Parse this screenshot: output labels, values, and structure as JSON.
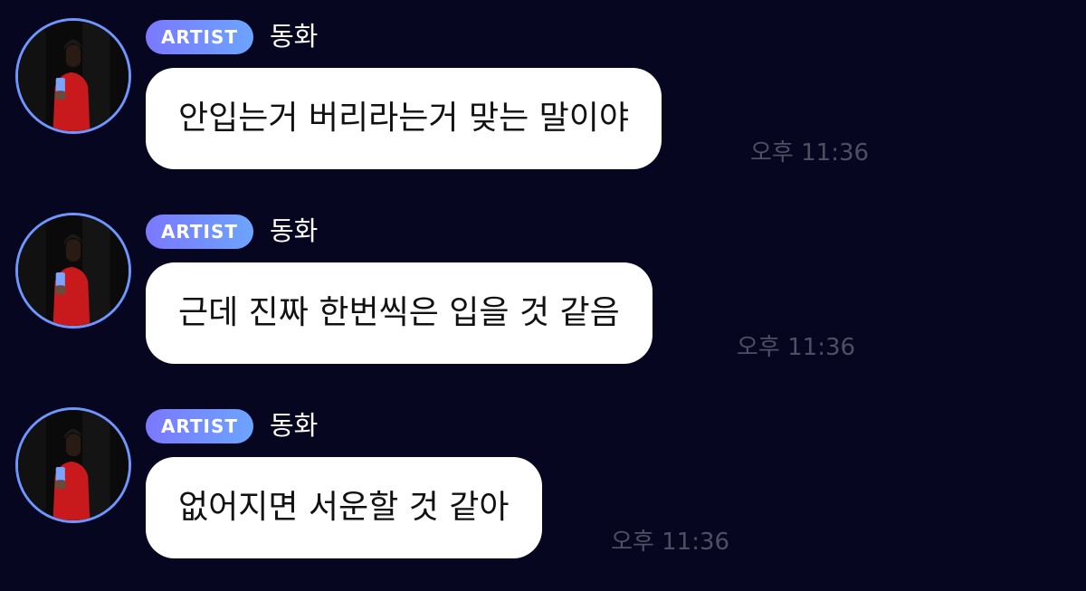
{
  "messages": [
    {
      "badge": "ARTIST",
      "sender": "동화",
      "text": "안입는거 버리라는거 맞는 말이야",
      "time": "오후 11:36"
    },
    {
      "badge": "ARTIST",
      "sender": "동화",
      "text": "근데 진짜 한번씩은 입을 것 같음",
      "time": "오후 11:36"
    },
    {
      "badge": "ARTIST",
      "sender": "동화",
      "text": "없어지면 서운할 것 같아",
      "time": "오후 11:36"
    }
  ],
  "colors": {
    "background": "#060620",
    "avatar_ring": "#6f96ff",
    "badge_gradient_start": "#7b78ff",
    "badge_gradient_end": "#6ca4ff",
    "bubble": "#ffffff",
    "timestamp": "#4f4f64"
  }
}
